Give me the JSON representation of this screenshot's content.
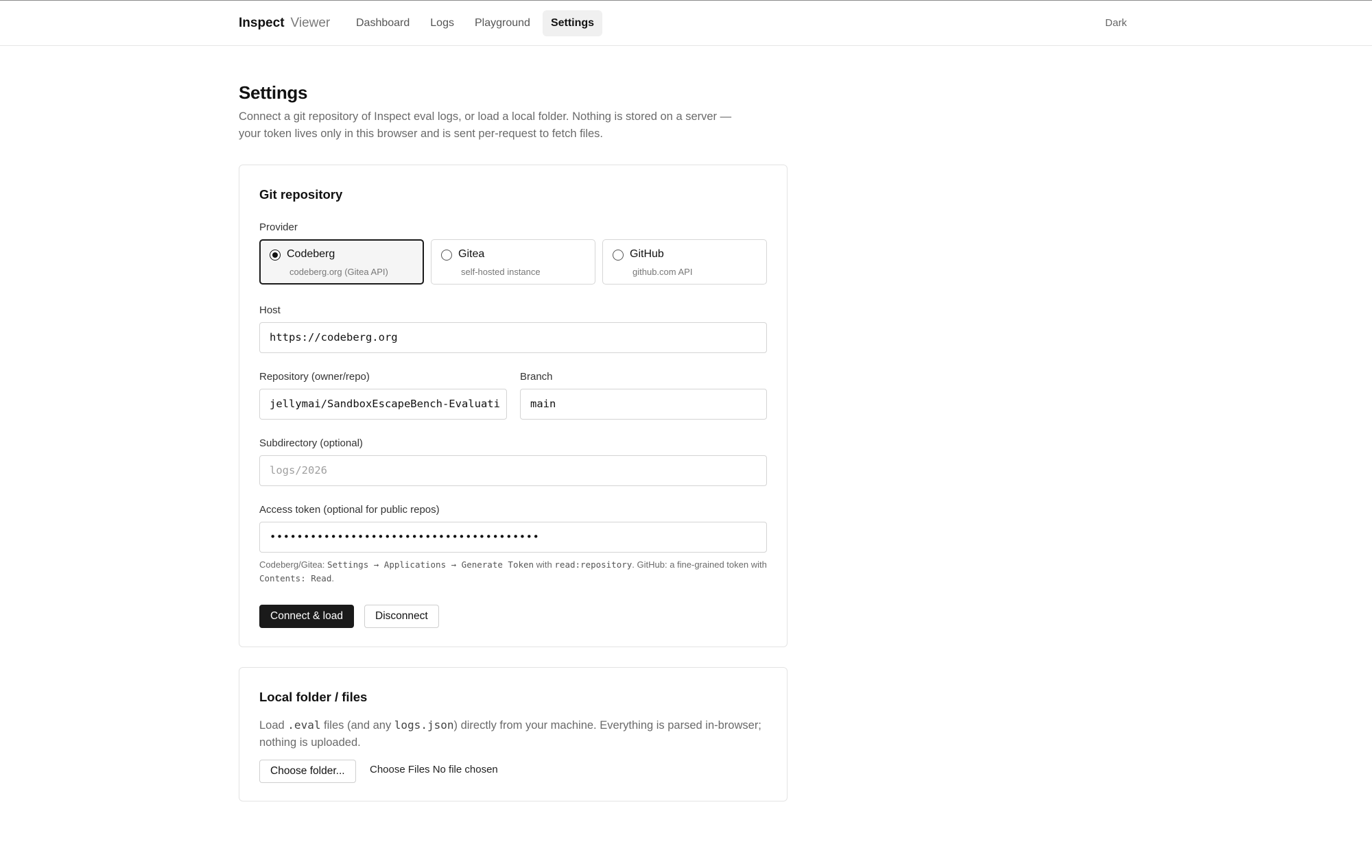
{
  "nav": {
    "brand_primary": "Inspect",
    "brand_secondary": "Viewer",
    "items": [
      {
        "label": "Dashboard",
        "active": false
      },
      {
        "label": "Logs",
        "active": false
      },
      {
        "label": "Playground",
        "active": false
      },
      {
        "label": "Settings",
        "active": true
      }
    ],
    "theme_toggle": "Dark"
  },
  "page": {
    "title": "Settings",
    "description": "Connect a git repository of Inspect eval logs, or load a local folder. Nothing is stored on a server — your token lives only in this browser and is sent per-request to fetch files."
  },
  "git": {
    "title": "Git repository",
    "provider_label": "Provider",
    "providers": [
      {
        "name": "Codeberg",
        "sub": "codeberg.org (Gitea API)",
        "selected": true
      },
      {
        "name": "Gitea",
        "sub": "self-hosted instance",
        "selected": false
      },
      {
        "name": "GitHub",
        "sub": "github.com API",
        "selected": false
      }
    ],
    "host_label": "Host",
    "host_value": "https://codeberg.org",
    "repo_label": "Repository (owner/repo)",
    "repo_value": "jellymai/SandboxEscapeBench-Evaluati",
    "branch_label": "Branch",
    "branch_value": "main",
    "subdir_label": "Subdirectory (optional)",
    "subdir_placeholder": "logs/2026",
    "token_label": "Access token (optional for public repos)",
    "token_value": "••••••••••••••••••••••••••••••••••••••••",
    "hint": {
      "t1": "Codeberg/Gitea: ",
      "m1": "Settings → Applications → Generate Token",
      "t2": " with ",
      "m2": "read:repository",
      "t3": ". GitHub: a fine-grained token with ",
      "m3": "Contents: Read",
      "t4": "."
    },
    "connect_label": "Connect & load",
    "disconnect_label": "Disconnect"
  },
  "local": {
    "title": "Local folder / files",
    "desc_t1": "Load ",
    "desc_m1": ".eval",
    "desc_t2": " files (and any ",
    "desc_m2": "logs.json",
    "desc_t3": ") directly from your machine. Everything is parsed in-browser; nothing is uploaded.",
    "choose_folder_label": "Choose folder...",
    "choose_files_label": "Choose Files",
    "no_file_label": "No file chosen"
  }
}
